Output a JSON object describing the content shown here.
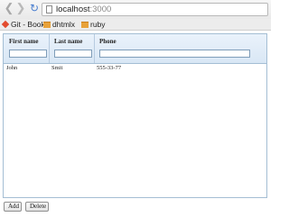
{
  "browser": {
    "url_host": "localhost",
    "url_port": ":3000",
    "bookmarks": [
      {
        "label": "Git - Book",
        "icon": "git-icon"
      },
      {
        "label": "dhtmlx",
        "icon": "folder-icon"
      },
      {
        "label": "ruby",
        "icon": "folder-icon"
      }
    ]
  },
  "grid": {
    "columns": [
      "First name",
      "Last name",
      "Phone"
    ],
    "rows": [
      {
        "first_name": "John",
        "last_name": "Smit",
        "phone": "555-33-77"
      }
    ]
  },
  "actions": {
    "add_label": "Add",
    "delete_label": "Delete"
  }
}
